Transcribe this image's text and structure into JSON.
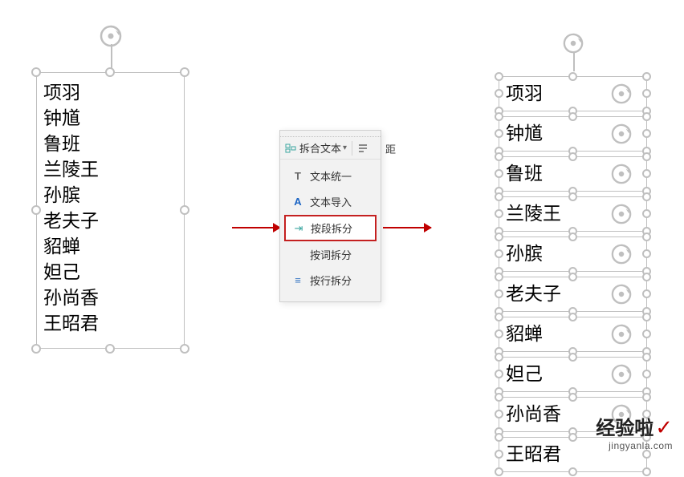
{
  "left_box": {
    "lines": [
      "项羽",
      "钟馗",
      "鲁班",
      "兰陵王",
      "孙膑",
      "老夫子",
      "貂蝉",
      "妲己",
      "孙尚香",
      "王昭君"
    ]
  },
  "menu": {
    "header_label": "拆合文本",
    "items": [
      {
        "icon": "T",
        "icon_color": "#666",
        "label": "文本统一"
      },
      {
        "icon": "A",
        "icon_color": "#1b64c4",
        "label": "文本导入"
      },
      {
        "icon": "⇥",
        "icon_color": "#3aa6a0",
        "label": "按段拆分",
        "highlight": true
      },
      {
        "icon": "",
        "icon_color": "#666",
        "label": "按词拆分"
      },
      {
        "icon": "≡",
        "icon_color": "#3a78c4",
        "label": "按行拆分"
      }
    ],
    "right_frag": "距"
  },
  "right_stack": {
    "items": [
      "项羽",
      "钟馗",
      "鲁班",
      "兰陵王",
      "孙膑",
      "老夫子",
      "貂蝉",
      "妲己",
      "孙尚香",
      "王昭君"
    ]
  },
  "watermark": {
    "main": "经验啦",
    "sub": "jingyanla.com"
  }
}
